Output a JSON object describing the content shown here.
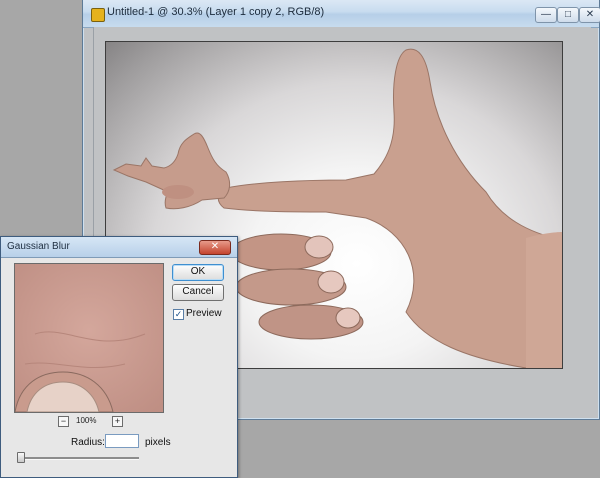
{
  "document": {
    "title": "Untitled-1 @ 30.3% (Layer 1 copy 2, RGB/8)",
    "window_buttons": {
      "minimize": "—",
      "maximize": "□",
      "close": "✕"
    }
  },
  "dialog": {
    "title": "Gaussian Blur",
    "close": "✕",
    "ok_label": "OK",
    "cancel_label": "Cancel",
    "preview_label": "Preview",
    "preview_checked": "✓",
    "zoom_out": "−",
    "zoom_in": "+",
    "zoom_level": "100%",
    "radius_label": "Radius:",
    "radius_value": "0.5",
    "radius_units": "pixels"
  },
  "colors": {
    "skin": "#c9a08f",
    "accent": "#3169c6"
  }
}
